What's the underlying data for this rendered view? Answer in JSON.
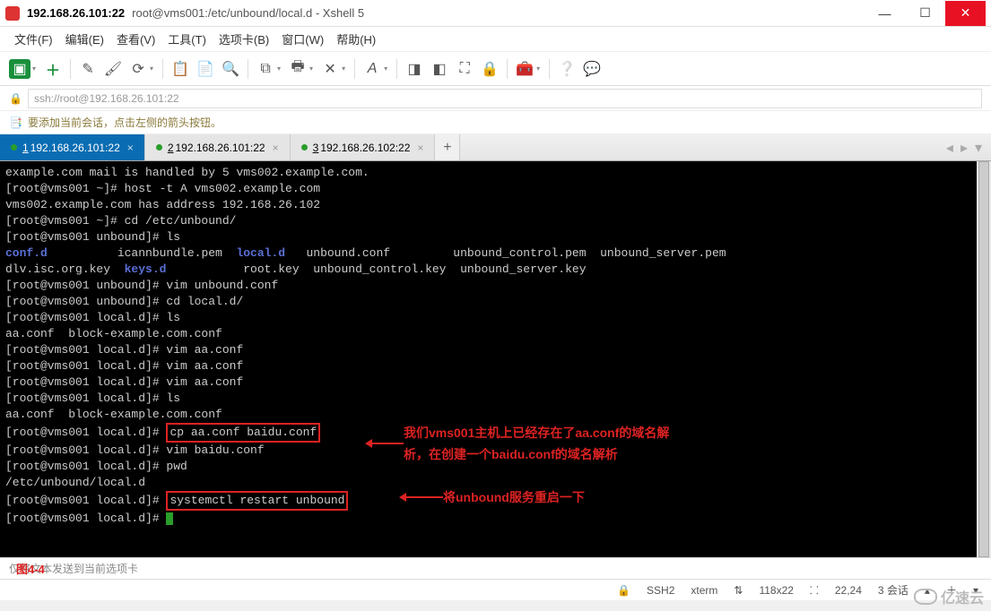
{
  "title": {
    "ip": "192.168.26.101:22",
    "path": "root@vms001:/etc/unbound/local.d - Xshell 5"
  },
  "menu": {
    "file": "文件(F)",
    "edit": "编辑(E)",
    "view": "查看(V)",
    "tools": "工具(T)",
    "tab": "选项卡(B)",
    "window": "窗口(W)",
    "help": "帮助(H)"
  },
  "addressbar": {
    "url": "ssh://root@192.168.26.101:22"
  },
  "tipbar": {
    "text": "要添加当前会话，点击左侧的箭头按钮。"
  },
  "tabs": {
    "items": [
      {
        "num": "1",
        "label": "192.168.26.101:22",
        "active": true
      },
      {
        "num": "2",
        "label": "192.168.26.101:22",
        "active": false
      },
      {
        "num": "3",
        "label": "192.168.26.102:22",
        "active": false
      }
    ]
  },
  "terminal": {
    "lines": [
      {
        "t": "example.com mail is handled by 5 vms002.example.com."
      },
      {
        "t": "[root@vms001 ~]# host -t A vms002.example.com"
      },
      {
        "t": "vms002.example.com has address 192.168.26.102"
      },
      {
        "t": "[root@vms001 ~]# cd /etc/unbound/"
      },
      {
        "t": "[root@vms001 unbound]# ls"
      },
      {
        "ls1a": "conf.d",
        "ls1b": "          icannbundle.pem  ",
        "ls1c": "local.d",
        "ls1d": "   unbound.conf         unbound_control.pem  unbound_server.pem"
      },
      {
        "ls2a": "dlv.isc.org.key  ",
        "ls2b": "keys.d",
        "ls2c": "           root.key  unbound_control.key  unbound_server.key"
      },
      {
        "t": "[root@vms001 unbound]# vim unbound.conf"
      },
      {
        "t": "[root@vms001 unbound]# cd local.d/"
      },
      {
        "t": "[root@vms001 local.d]# ls"
      },
      {
        "t": "aa.conf  block-example.com.conf"
      },
      {
        "t": "[root@vms001 local.d]# vim aa.conf"
      },
      {
        "t": "[root@vms001 local.d]# vim aa.conf"
      },
      {
        "t": "[root@vms001 local.d]# vim aa.conf"
      },
      {
        "t": "[root@vms001 local.d]# ls"
      },
      {
        "t": "aa.conf  block-example.com.conf"
      },
      {
        "prompt": "[root@vms001 local.d]# ",
        "cmd": "cp aa.conf baidu.conf"
      },
      {
        "t": "[root@vms001 local.d]# vim baidu.conf"
      },
      {
        "t": "[root@vms001 local.d]# pwd"
      },
      {
        "t": "/etc/unbound/local.d"
      },
      {
        "prompt": "[root@vms001 local.d]# ",
        "cmd": "systemctl restart unbound"
      },
      {
        "t": "[root@vms001 local.d]# "
      }
    ],
    "annot1a": "我们vms001主机上已经存在了aa.conf的域名解",
    "annot1b": "析，在创建一个baidu.conf的域名解析",
    "annot2": "将unbound服务重启一下"
  },
  "footer": {
    "tip": "仅将文本发送到当前选项卡",
    "figlabel": "图4-4"
  },
  "status": {
    "conn": "SSH2",
    "term": "xterm",
    "size": "118x22",
    "pos": "22,24",
    "sessions": "3 会话"
  },
  "watermark": "亿速云"
}
